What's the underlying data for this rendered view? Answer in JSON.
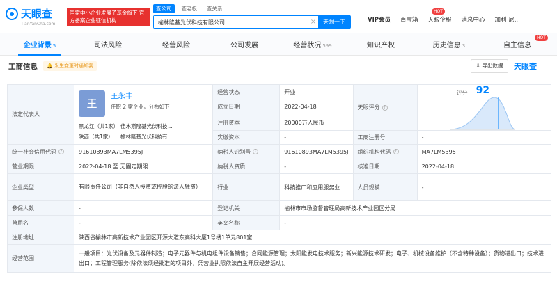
{
  "header": {
    "logo_text": "天眼查",
    "logo_sub": "TianYanCha.com",
    "badge": "国家中小企业发展子基金旗下 官方备案企业征信机构",
    "search_tabs": [
      "查公司",
      "查老板",
      "查关系"
    ],
    "search_value": "榆林隆基光伏科技有限公司",
    "search_button": "天眼一下",
    "nav": [
      "VIP会员",
      "百宝箱",
      "天眼企服",
      "消息中心",
      "加利 尼..."
    ],
    "hot_badge": "HOT"
  },
  "tabs": [
    {
      "label": "企业背景",
      "count": "5"
    },
    {
      "label": "司法风险",
      "count": ""
    },
    {
      "label": "经营风险",
      "count": ""
    },
    {
      "label": "公司发展",
      "count": ""
    },
    {
      "label": "经营状况",
      "count": "599"
    },
    {
      "label": "知识产权",
      "count": ""
    },
    {
      "label": "历史信息",
      "count": "3"
    },
    {
      "label": "自主信息",
      "count": ""
    }
  ],
  "section": {
    "title": "工商信息",
    "tag": "发生变更时通知我",
    "export": "导出数据",
    "watermark": "天眼查"
  },
  "legal_rep": {
    "label": "法定代表人",
    "avatar": "王",
    "name": "王永丰",
    "summary": "任职 2 家企业，分布如下",
    "regions": [
      {
        "region": "黑龙江（共1家）",
        "company": "佳木斯隆基光伏科技..."
      },
      {
        "region": "陕西（共1家）",
        "company": "榆林隆基光伏科技有..."
      }
    ]
  },
  "score": {
    "label": "天眼评分",
    "title": "评分",
    "value": "92"
  },
  "rows": {
    "status_label": "经营状态",
    "status": "开业",
    "founded_label": "成立日期",
    "founded": "2022-04-18",
    "capital_label": "注册资本",
    "capital": "20000万人民币",
    "paid_label": "实缴资本",
    "paid": "-",
    "regno_label": "工商注册号",
    "regno": "-",
    "credit_label": "统一社会信用代码",
    "credit": "91610893MA7LM5395J",
    "taxid_label": "纳税人识别号",
    "taxid": "91610893MA7LM5395J",
    "org_label": "组织机构代码",
    "org": "MA7LM5395",
    "term_label": "营业期限",
    "term": "2022-04-18 至 无固定期限",
    "taxq_label": "纳税人资质",
    "taxq": "-",
    "approve_label": "核准日期",
    "approve": "2022-04-18",
    "type_label": "企业类型",
    "type": "有限责任公司（非自然人投资或控股的法人独资）",
    "industry_label": "行业",
    "industry": "科技推广和应用服务业",
    "staff_label": "人员规模",
    "staff": "-",
    "insured_label": "参保人数",
    "insured": "-",
    "authority_label": "登记机关",
    "authority": "榆林市市场监督管理局高新技术产业园区分局",
    "formername_label": "曾用名",
    "formername": "-",
    "enname_label": "英文名称",
    "enname": "-",
    "address_label": "注册地址",
    "address": "陕西省榆林市高新技术产业园区开源大道东高科大厦1号楼1单元801室",
    "scope_label": "经营范围",
    "scope": "一般项目：光伏设备及元器件制造；电子元器件与机电组件设备销售；合同能源管理；太阳能发电技术服务；新兴能源技术研发；电子、机械设备维护（不含特种设备）；货物进出口；技术进出口；工程管理服务(除依法须经批准的项目外，凭营业执照依法自主开展经营活动)。"
  },
  "colors": {
    "accent": "#0084ff",
    "vip": "#e75e0c",
    "badge": "#e7312f"
  }
}
